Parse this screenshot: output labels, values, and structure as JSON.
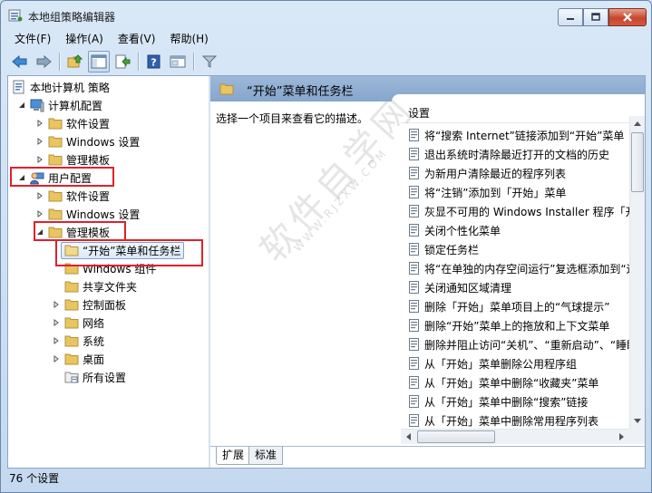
{
  "window": {
    "title": "本地组策略编辑器"
  },
  "menu": [
    "文件(F)",
    "操作(A)",
    "查看(V)",
    "帮助(H)"
  ],
  "toolbar": [
    "back-icon",
    "forward-icon",
    "up-folder-icon",
    "show-hide-tree-icon",
    "export-list-icon",
    "help-icon",
    "properties-icon",
    "filter-icon"
  ],
  "tree": {
    "root": "本地计算机 策略",
    "computer_config": "计算机配置",
    "computer_children": [
      "软件设置",
      "Windows 设置",
      "管理模板"
    ],
    "user_config": "用户配置",
    "user_children": [
      "软件设置",
      "Windows 设置"
    ],
    "admin_templates": "管理模板",
    "start_menu": "“开始”菜单和任务栏",
    "admin_children": [
      "Windows 组件",
      "共享文件夹",
      "控制面板",
      "网络",
      "系统",
      "桌面",
      "所有设置"
    ]
  },
  "right": {
    "header_title": "“开始”菜单和任务栏",
    "description": "选择一个项目来查看它的描述。",
    "column_header": "设置",
    "policies": [
      "将“搜索 Internet”链接添加到“开始”菜单",
      "退出系统时清除最近打开的文档的历史",
      "为新用户清除最近的程序列表",
      "将“注销”添加到「开始」菜单",
      "灰显不可用的 Windows Installer 程序「开始」菜单快捷方式",
      "关闭个性化菜单",
      "锁定任务栏",
      "将“在单独的内存空间运行”复选框添加到“运行”对话框",
      "关闭通知区域清理",
      "删除「开始」菜单项目上的“气球提示”",
      "删除“开始”菜单上的拖放和上下文菜单",
      "删除并阻止访问“关机”、“重新启动”、“睡眠”和“休眠”命令",
      "从「开始」菜单删除公用程序组",
      "从「开始」菜单中删除“收藏夹”菜单",
      "从「开始」菜单中删除“搜索”链接",
      "从「开始」菜单中删除常用程序列表"
    ]
  },
  "tabs": [
    "扩展",
    "标准"
  ],
  "status": "76 个设置",
  "watermark": {
    "main": "软件自学网",
    "sub": "WWW.RJZXW.COM"
  },
  "colors": {
    "highlight_box": "#e0202a",
    "header_bar": "#86a6cc",
    "folder": "#e8c560"
  }
}
